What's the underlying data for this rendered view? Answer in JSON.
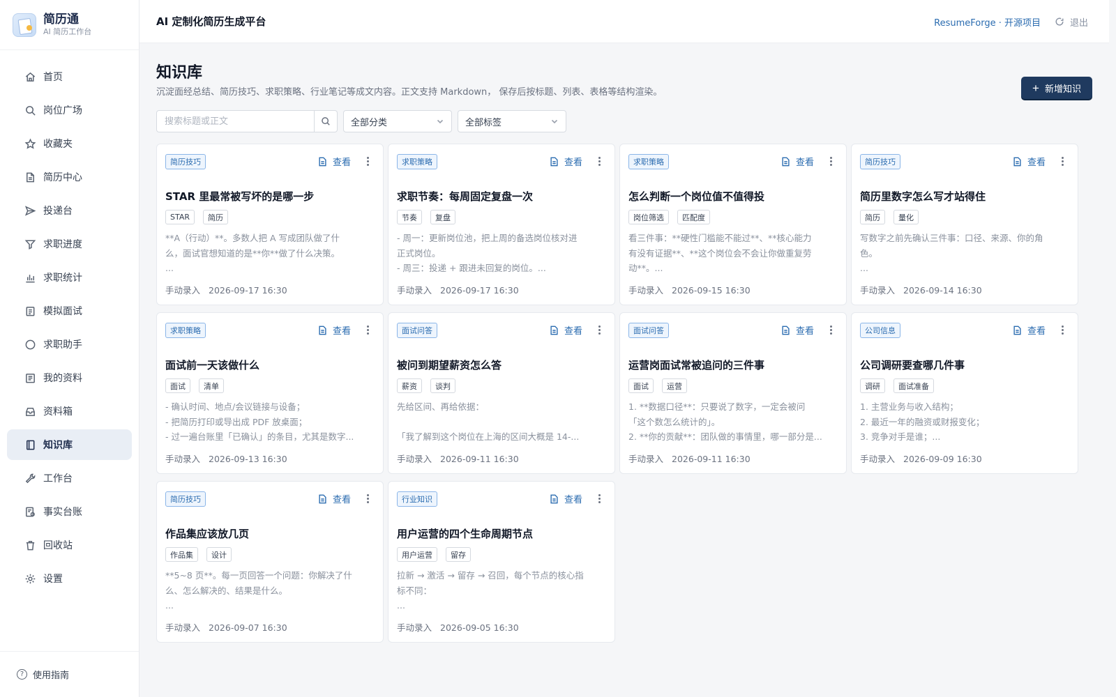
{
  "brand": {
    "name": "简历通",
    "subtitle": "AI 简历工作台"
  },
  "sidebar": {
    "items": [
      {
        "label": "首页",
        "icon": "home-icon"
      },
      {
        "label": "岗位广场",
        "icon": "search-icon"
      },
      {
        "label": "收藏夹",
        "icon": "star-icon"
      },
      {
        "label": "简历中心",
        "icon": "document-icon"
      },
      {
        "label": "投递台",
        "icon": "send-icon"
      },
      {
        "label": "求职进度",
        "icon": "filter-icon"
      },
      {
        "label": "求职统计",
        "icon": "bar-chart-icon"
      },
      {
        "label": "模拟面试",
        "icon": "clipboard-icon"
      },
      {
        "label": "求职助手",
        "icon": "chat-icon"
      },
      {
        "label": "我的资料",
        "icon": "profile-list-icon"
      },
      {
        "label": "资料箱",
        "icon": "inbox-icon"
      },
      {
        "label": "知识库",
        "icon": "book-icon",
        "active": true
      },
      {
        "label": "工作台",
        "icon": "wrench-icon"
      },
      {
        "label": "事实台账",
        "icon": "ledger-icon"
      },
      {
        "label": "回收站",
        "icon": "trash-icon"
      },
      {
        "label": "设置",
        "icon": "gear-icon"
      }
    ],
    "guide_label": "使用指南"
  },
  "topbar": {
    "title": "AI 定制化简历生成平台",
    "open_source_link": "ResumeForge · 开源项目",
    "logout_label": "退出"
  },
  "page": {
    "title": "知识库",
    "description": "沉淀面经总结、简历技巧、求职策略、行业笔记等成文内容。正文支持 Markdown， 保存后按标题、列表、表格等结构渲染。",
    "add_button": "新增知识"
  },
  "filters": {
    "search_placeholder": "搜索标题或正文",
    "category_select": "全部分类",
    "tag_select": "全部标签"
  },
  "card_view_label": "查看",
  "cards": [
    {
      "category": "简历技巧",
      "title": "STAR 里最常被写坏的是哪一步",
      "tags": [
        "STAR",
        "简历"
      ],
      "excerpt": "**A（行动）**。多数人把 A 写成团队做了什\n么，面试官想知道的是**你**做了什么决策。\n...",
      "source": "手动录入",
      "time": "2026-09-17 16:30"
    },
    {
      "category": "求职策略",
      "title": "求职节奏：每周固定复盘一次",
      "tags": [
        "节奏",
        "复盘"
      ],
      "excerpt": "- 周一：更新岗位池，把上周的备选岗位核对进\n正式岗位。\n- 周三：投递 + 跟进未回复的岗位。...",
      "source": "手动录入",
      "time": "2026-09-17 16:30"
    },
    {
      "category": "求职策略",
      "title": "怎么判断一个岗位值不值得投",
      "tags": [
        "岗位筛选",
        "匹配度"
      ],
      "excerpt": "看三件事：**硬性门槛能不能过**、**核心能力\n有没有证据**、**这个岗位会不会让你做重复劳\n动**。...",
      "source": "手动录入",
      "time": "2026-09-15 16:30"
    },
    {
      "category": "简历技巧",
      "title": "简历里数字怎么写才站得住",
      "tags": [
        "简历",
        "量化"
      ],
      "excerpt": "写数字之前先确认三件事：口径、来源、你的角\n色。\n...",
      "source": "手动录入",
      "time": "2026-09-14 16:30"
    },
    {
      "category": "求职策略",
      "title": "面试前一天该做什么",
      "tags": [
        "面试",
        "清单"
      ],
      "excerpt": "- 确认时间、地点/会议链接与设备；\n- 把简历打印或导出成 PDF 放桌面；\n- 过一遍台账里「已确认」的条目，尤其是数字...",
      "source": "手动录入",
      "time": "2026-09-13 16:30"
    },
    {
      "category": "面试问答",
      "title": "被问到期望薪资怎么答",
      "tags": [
        "薪资",
        "谈判"
      ],
      "excerpt": "先给区间、再给依据：\n\n「我了解到这个岗位在上海的区间大概是 14-...",
      "source": "手动录入",
      "time": "2026-09-11 16:30"
    },
    {
      "category": "面试问答",
      "title": "运营岗面试常被追问的三件事",
      "tags": [
        "面试",
        "运营"
      ],
      "excerpt": "1. **数据口径**：只要说了数字，一定会被问\n「这个数怎么统计的」。\n2. **你的贡献**：团队做的事情里，哪一部分是...",
      "source": "手动录入",
      "time": "2026-09-11 16:30"
    },
    {
      "category": "公司信息",
      "title": "公司调研要查哪几件事",
      "tags": [
        "调研",
        "面试准备"
      ],
      "excerpt": "1. 主营业务与收入结构；\n2. 最近一年的融资或财报变化；\n3. 竞争对手是谁；...",
      "source": "手动录入",
      "time": "2026-09-09 16:30"
    },
    {
      "category": "简历技巧",
      "title": "作品集应该放几页",
      "tags": [
        "作品集",
        "设计"
      ],
      "excerpt": "**5~8 页**。每一页回答一个问题：你解决了什\n么、怎么解决的、结果是什么。\n...",
      "source": "手动录入",
      "time": "2026-09-07 16:30"
    },
    {
      "category": "行业知识",
      "title": "用户运营的四个生命周期节点",
      "tags": [
        "用户运营",
        "留存"
      ],
      "excerpt": "拉新 → 激活 → 留存 → 召回，每个节点的核心指\n标不同：\n...",
      "source": "手动录入",
      "time": "2026-09-05 16:30"
    }
  ]
}
